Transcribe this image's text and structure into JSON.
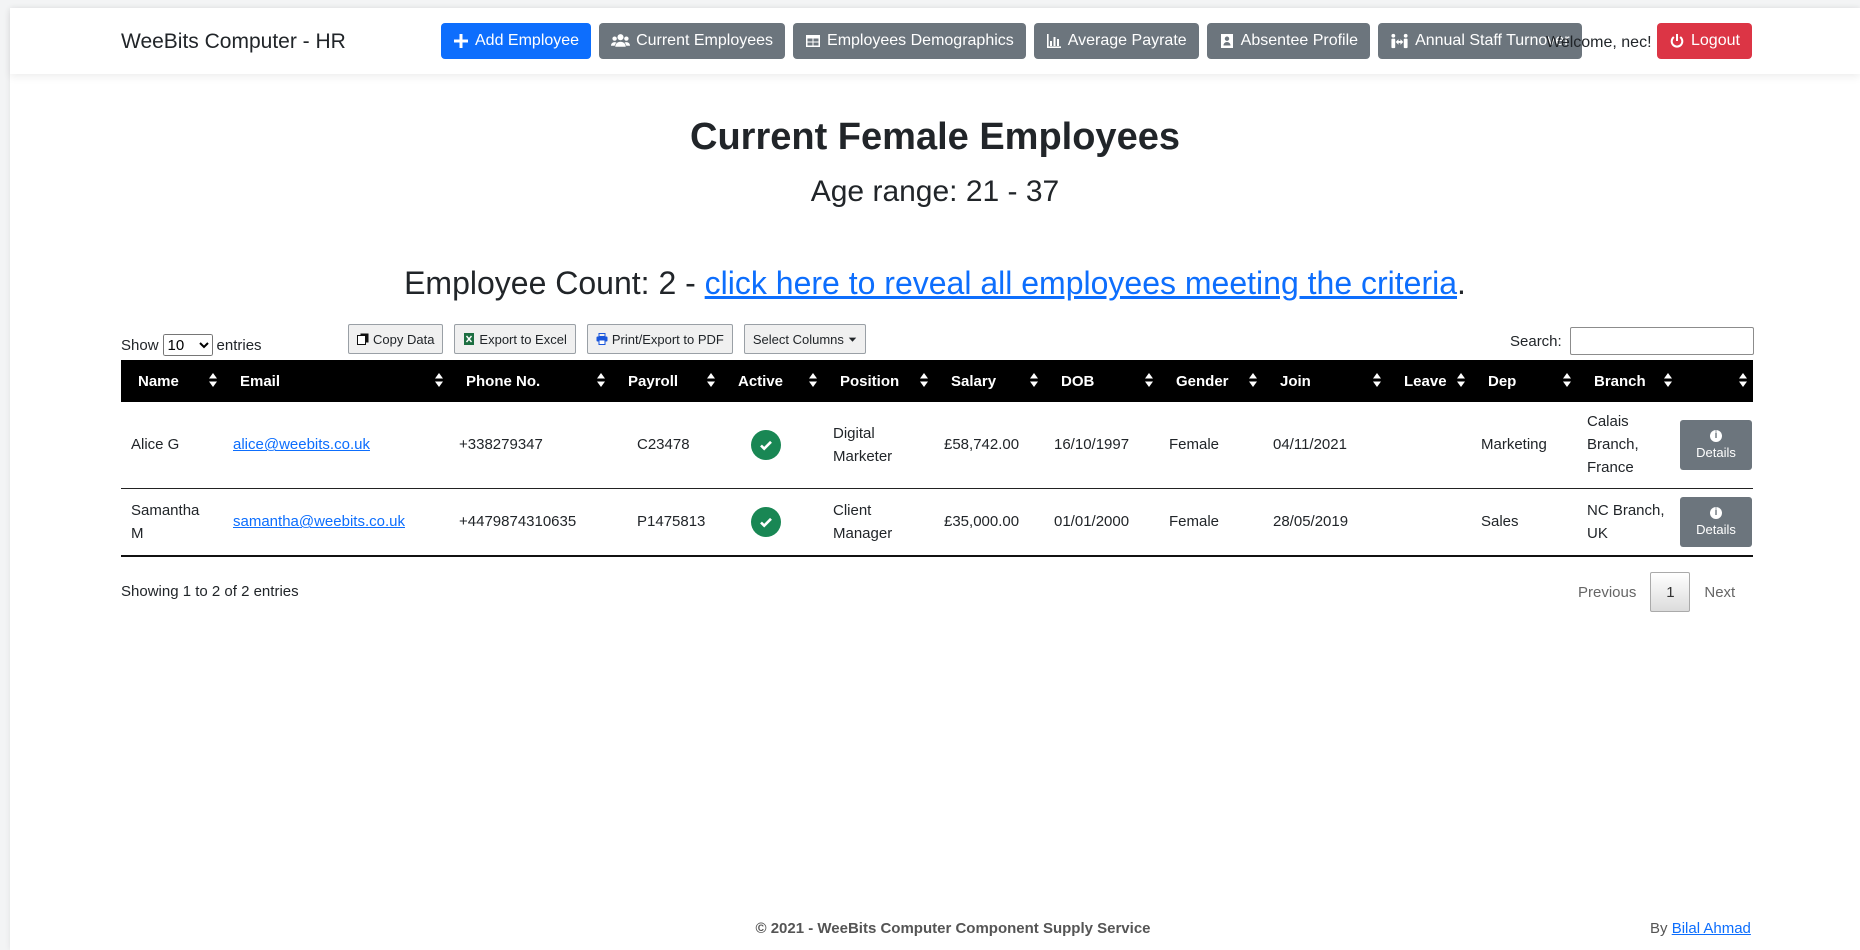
{
  "nav": {
    "brand": "WeeBits Computer - HR",
    "buttons": [
      {
        "label": "Add Employee",
        "icon": "plus-icon"
      },
      {
        "label": "Current Employees",
        "icon": "users-icon"
      },
      {
        "label": "Employees Demographics",
        "icon": "table-icon"
      },
      {
        "label": "Average Payrate",
        "icon": "chart-icon"
      },
      {
        "label": "Absentee Profile",
        "icon": "id-card-icon"
      },
      {
        "label": "Annual Staff Turnover",
        "icon": "people-arrows-icon"
      }
    ],
    "welcome": "Welcome, nec!",
    "logout": "Logout"
  },
  "heading": {
    "title": "Current Female Employees",
    "subtitle": "Age range: 21 - 37",
    "count_prefix": "Employee Count: 2 - ",
    "count_link": "click here to reveal all employees meeting the criteria",
    "count_suffix": "."
  },
  "controls": {
    "show_label": "Show",
    "entries_value": "10",
    "entries_label": "entries",
    "copy": "Copy Data",
    "excel": "Export to Excel",
    "pdf": "Print/Export to PDF",
    "columns": "Select Columns",
    "search_label": "Search:",
    "search_value": ""
  },
  "table": {
    "columns": [
      "Name",
      "Email",
      "Phone No.",
      "Payroll",
      "Active",
      "Position",
      "Salary",
      "DOB",
      "Gender",
      "Join",
      "Leave",
      "Dep",
      "Branch",
      ""
    ],
    "rows": [
      {
        "name": "Alice G",
        "email": "alice@weebits.co.uk",
        "phone": "+338279347",
        "payroll": "C23478",
        "position": "Digital Marketer",
        "salary": "£58,742.00",
        "dob": "16/10/1997",
        "gender": "Female",
        "join": "04/11/2021",
        "leave": "",
        "dep": "Marketing",
        "branch": "Calais Branch, France",
        "details": "Details"
      },
      {
        "name": "Samantha M",
        "email": "samantha@weebits.co.uk",
        "phone": "+4479874310635",
        "payroll": "P1475813",
        "position": "Client Manager",
        "salary": "£35,000.00",
        "dob": "01/01/2000",
        "gender": "Female",
        "join": "28/05/2019",
        "leave": "",
        "dep": "Sales",
        "branch": "NC Branch, UK",
        "details": "Details"
      }
    ]
  },
  "pagination": {
    "info": "Showing 1 to 2 of 2 entries",
    "previous": "Previous",
    "current": "1",
    "next": "Next"
  },
  "footer": {
    "copyright": "© 2021 - WeeBits Computer Component Supply Service",
    "by": "By ",
    "author": "Bilal Ahmad"
  },
  "colors": {
    "primary": "#0d6efd",
    "secondary": "#6c757d",
    "danger": "#dc3545",
    "success": "#198754",
    "table_header": "#000000"
  }
}
